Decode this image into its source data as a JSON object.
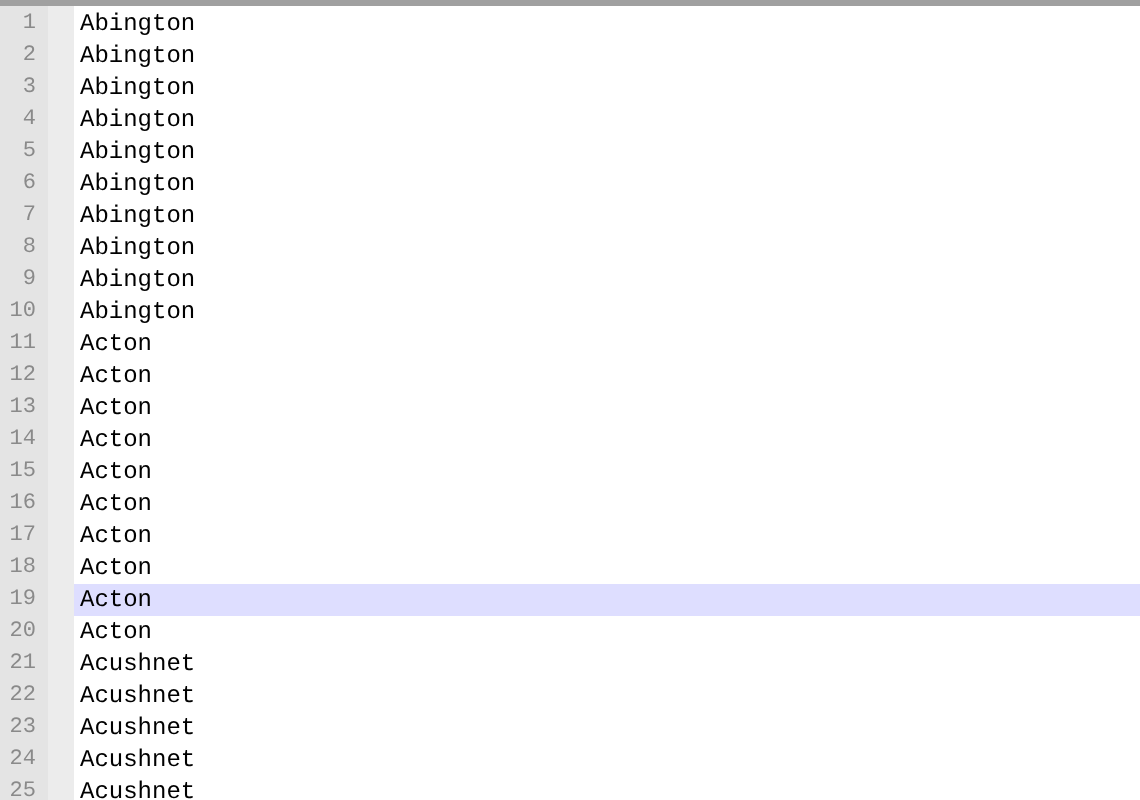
{
  "editor": {
    "lines": [
      {
        "number": "1",
        "text": "Abington",
        "current": false
      },
      {
        "number": "2",
        "text": "Abington",
        "current": false
      },
      {
        "number": "3",
        "text": "Abington",
        "current": false
      },
      {
        "number": "4",
        "text": "Abington",
        "current": false
      },
      {
        "number": "5",
        "text": "Abington",
        "current": false
      },
      {
        "number": "6",
        "text": "Abington",
        "current": false
      },
      {
        "number": "7",
        "text": "Abington",
        "current": false
      },
      {
        "number": "8",
        "text": "Abington",
        "current": false
      },
      {
        "number": "9",
        "text": "Abington",
        "current": false
      },
      {
        "number": "10",
        "text": "Abington",
        "current": false
      },
      {
        "number": "11",
        "text": "Acton",
        "current": false
      },
      {
        "number": "12",
        "text": "Acton",
        "current": false
      },
      {
        "number": "13",
        "text": "Acton",
        "current": false
      },
      {
        "number": "14",
        "text": "Acton",
        "current": false
      },
      {
        "number": "15",
        "text": "Acton",
        "current": false
      },
      {
        "number": "16",
        "text": "Acton",
        "current": false
      },
      {
        "number": "17",
        "text": "Acton",
        "current": false
      },
      {
        "number": "18",
        "text": "Acton",
        "current": false
      },
      {
        "number": "19",
        "text": "Acton",
        "current": true
      },
      {
        "number": "20",
        "text": "Acton",
        "current": false
      },
      {
        "number": "21",
        "text": "Acushnet",
        "current": false
      },
      {
        "number": "22",
        "text": "Acushnet",
        "current": false
      },
      {
        "number": "23",
        "text": "Acushnet",
        "current": false
      },
      {
        "number": "24",
        "text": "Acushnet",
        "current": false
      },
      {
        "number": "25",
        "text": "Acushnet",
        "current": false
      }
    ]
  }
}
